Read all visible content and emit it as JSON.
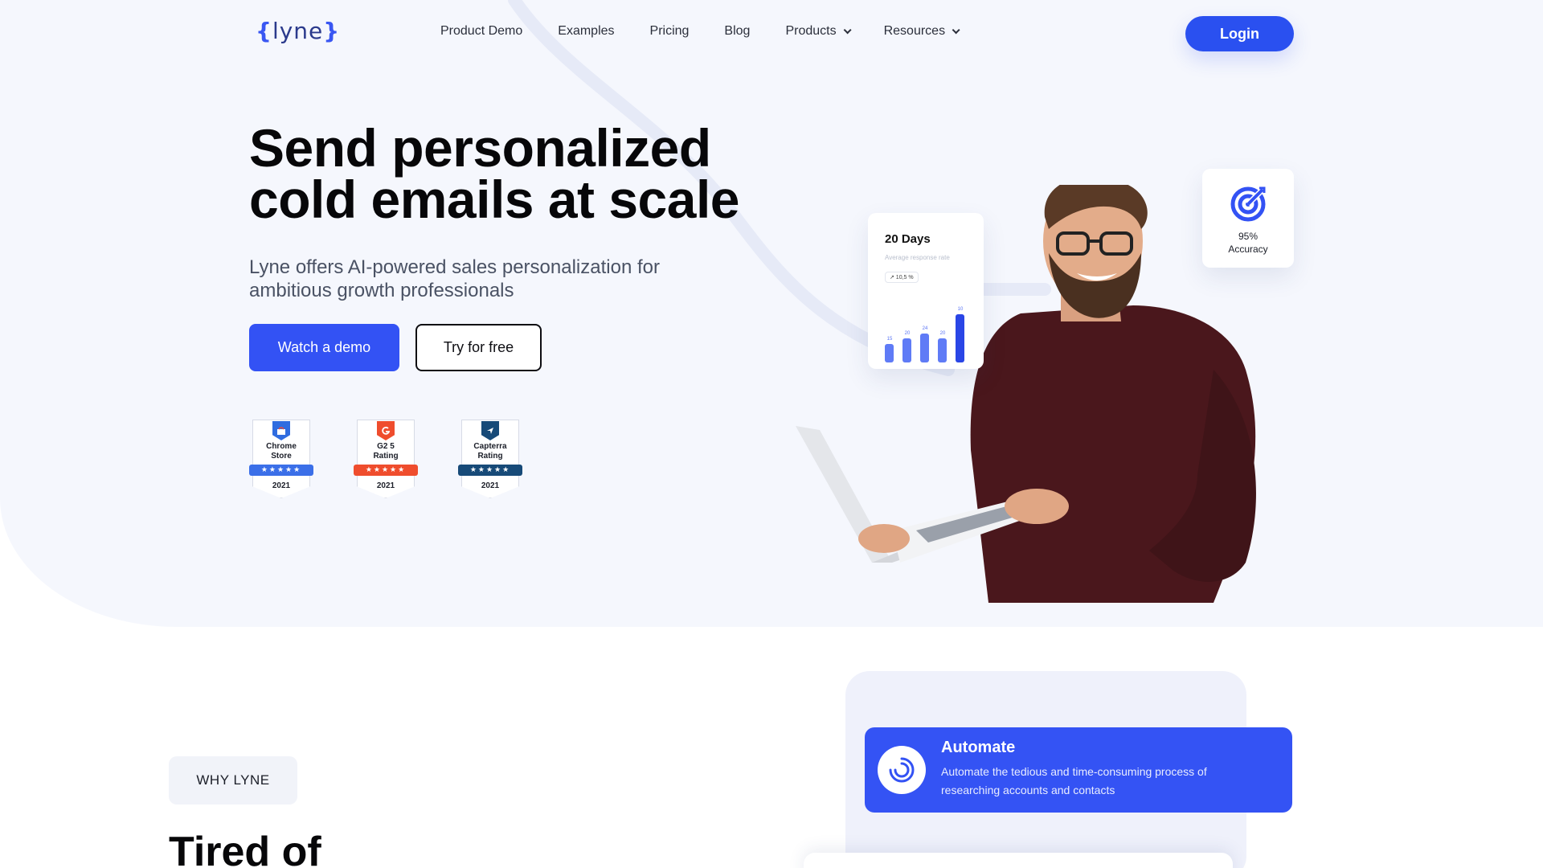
{
  "nav": {
    "logo_open": "{",
    "logo_text": "lyne",
    "logo_close": "}",
    "links": [
      "Product Demo",
      "Examples",
      "Pricing",
      "Blog",
      "Products",
      "Resources"
    ],
    "login": "Login"
  },
  "hero": {
    "title": "Send personalized cold emails at scale",
    "subtitle": "Lyne offers AI-powered sales personalization for ambitious growth professionals",
    "cta_primary": "Watch a demo",
    "cta_secondary": "Try for free"
  },
  "badges": [
    {
      "label_1": "Chrome",
      "label_2": "Store",
      "year": "2021",
      "ribbon_color": "#3b6fe8",
      "icon_color": "#2f6ce0",
      "icon": "chrome-store-icon",
      "stars": "★★★★★"
    },
    {
      "label_1": "G2 5",
      "label_2": "Rating",
      "year": "2021",
      "ribbon_color": "#ef4d2d",
      "icon_color": "#ef4d2d",
      "icon": "g2-icon",
      "stars": "★★★★★"
    },
    {
      "label_1": "Capterra",
      "label_2": "Rating",
      "year": "2021",
      "ribbon_color": "#174a78",
      "icon_color": "#174a78",
      "icon": "capterra-icon",
      "stars": "★★★★★"
    }
  ],
  "stat_card": {
    "title": "20 Days",
    "caption": "Average response rate",
    "pill": "↗ 10,5 %",
    "bars": [
      {
        "label": "15",
        "value": 15
      },
      {
        "label": "20",
        "value": 20
      },
      {
        "label": "24",
        "value": 24
      },
      {
        "label": "20",
        "value": 20
      },
      {
        "label": "10",
        "value": 40
      }
    ]
  },
  "accuracy": {
    "value": "95%",
    "label": "Accuracy",
    "icon": "target-icon"
  },
  "why": {
    "pill": "WHY LYNE",
    "heading": "Tired of"
  },
  "feature": {
    "title": "Automate",
    "description": "Automate the tedious and time-consuming process of researching accounts and contacts",
    "icon": "spinner-icon"
  },
  "colors": {
    "accent": "#3352f4",
    "hero_bg": "#f5f7fd"
  }
}
